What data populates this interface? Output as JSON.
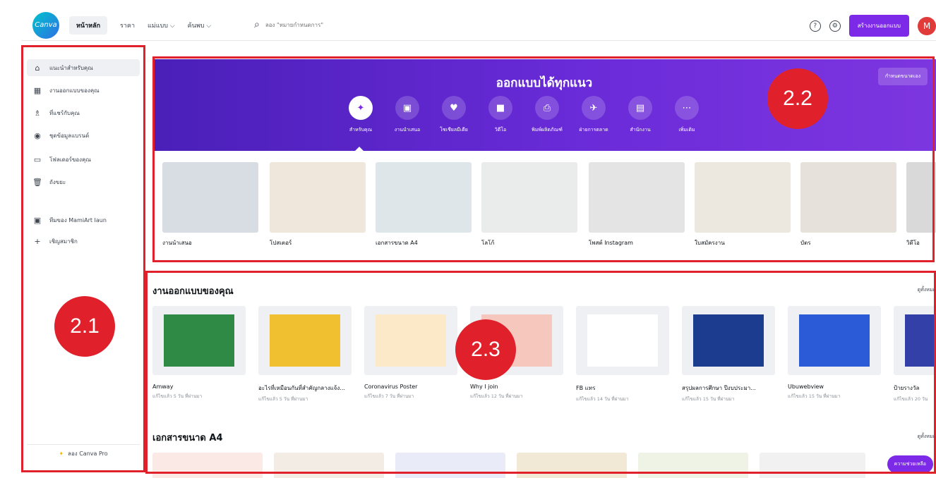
{
  "topbar": {
    "logo": "Canva",
    "nav": [
      "หน้าหลัก",
      "ราคา",
      "แม่แบบ ⌵",
      "ค้นพบ ⌵"
    ],
    "search_placeholder": "ลอง \"หมายกำหนดการ\"",
    "create_label": "สร้างงานออกแบบ",
    "avatar_initial": "M"
  },
  "sidebar": {
    "items": [
      {
        "icon": "home-icon",
        "glyph": "⌂",
        "label": "แนะนำสำหรับคุณ"
      },
      {
        "icon": "grid-icon",
        "glyph": "▦",
        "label": "งานออกแบบของคุณ"
      },
      {
        "icon": "shared-icon",
        "glyph": "♗",
        "label": "ที่แชร์กับคุณ"
      },
      {
        "icon": "brand-kit-icon",
        "glyph": "◉",
        "label": "ชุดข้อมูลแบรนด์"
      },
      {
        "icon": "folder-icon",
        "glyph": "▭",
        "label": "โฟลเดอร์ของคุณ"
      },
      {
        "icon": "trash-icon",
        "glyph": "🗑",
        "label": "ถังขยะ"
      },
      {
        "icon": "team-icon",
        "glyph": "▣",
        "label": "ทีมของ MamiArt Iaun"
      },
      {
        "icon": "plus-icon",
        "glyph": "+",
        "label": "เชิญสมาชิก"
      }
    ],
    "pro_label": "ลอง Canva Pro"
  },
  "hero": {
    "title": "ออกแบบได้ทุกแนว",
    "custom_size_label": "กำหนดขนาดเอง",
    "categories": [
      {
        "icon": "sparkle-icon",
        "glyph": "✦",
        "label": "สำหรับคุณ"
      },
      {
        "icon": "presentation-icon",
        "glyph": "▣",
        "label": "งานนำเสนอ"
      },
      {
        "icon": "social-media-icon",
        "glyph": "♥",
        "label": "โซเชียลมีเดีย"
      },
      {
        "icon": "video-icon",
        "glyph": "■",
        "label": "วิดีโอ"
      },
      {
        "icon": "print-icon",
        "glyph": "⎙",
        "label": "พิมพ์ผลิตภัณฑ์"
      },
      {
        "icon": "marketing-icon",
        "glyph": "✈",
        "label": "ฝ่ายการตลาด"
      },
      {
        "icon": "office-icon",
        "glyph": "▤",
        "label": "สำนักงาน"
      },
      {
        "icon": "more-icon",
        "glyph": "⋯",
        "label": "เพิ่มเติม"
      }
    ]
  },
  "templates": [
    {
      "label": "งานนำเสนอ",
      "color": "#d8dde3"
    },
    {
      "label": "โปสเตอร์",
      "color": "#efe7dc"
    },
    {
      "label": "เอกสารขนาด A4",
      "color": "#dfe6ea"
    },
    {
      "label": "โลโก้",
      "color": "#e9ecea"
    },
    {
      "label": "โพสต์ Instagram",
      "color": "#e4e4e4"
    },
    {
      "label": "ใบสมัครงาน",
      "color": "#ece7df"
    },
    {
      "label": "บัตร",
      "color": "#e6e1da"
    },
    {
      "label": "วิดีโอ",
      "color": "#d9d9d9"
    }
  ],
  "your_designs": {
    "title": "งานออกแบบของคุณ",
    "see_all": "ดูทั้งหมด",
    "items": [
      {
        "name": "Amway",
        "meta": "แก้ไขแล้ว 5 วัน ที่ผ่านมา",
        "color": "#2f8a46"
      },
      {
        "name": "อะไรที่เหมือนกันที่สำคัญกลางแจ้ง...",
        "meta": "แก้ไขแล้ว 5 วัน ที่ผ่านมา",
        "color": "#f0c030"
      },
      {
        "name": "Coronavirus Poster",
        "meta": "แก้ไขแล้ว 7 วัน ที่ผ่านมา",
        "color": "#fbe9c8"
      },
      {
        "name": "Why I join",
        "meta": "แก้ไขแล้ว 12 วัน ที่ผ่านมา",
        "color": "#f6c8bd"
      },
      {
        "name": "FB แทร",
        "meta": "แก้ไขแล้ว 14 วัน ที่ผ่านมา",
        "color": "#ffffff"
      },
      {
        "name": "สรุปผลการศึกษา ปีงบประมา...",
        "meta": "แก้ไขแล้ว 15 วัน ที่ผ่านมา",
        "color": "#1c3d8f"
      },
      {
        "name": "Ubuwebview",
        "meta": "แก้ไขแล้ว 15 วัน ที่ผ่านมา",
        "color": "#2c5bd8"
      },
      {
        "name": "ป้ายรางวัล",
        "meta": "แก้ไขแล้ว 20 วัน",
        "color": "#3340a8"
      }
    ]
  },
  "a4_section": {
    "title": "เอกสารขนาด A4",
    "see_all": "ดูทั้งหมด",
    "help_label": "ความช่วยเหลือ"
  },
  "annotations": [
    "2.1",
    "2.2",
    "2.3"
  ]
}
